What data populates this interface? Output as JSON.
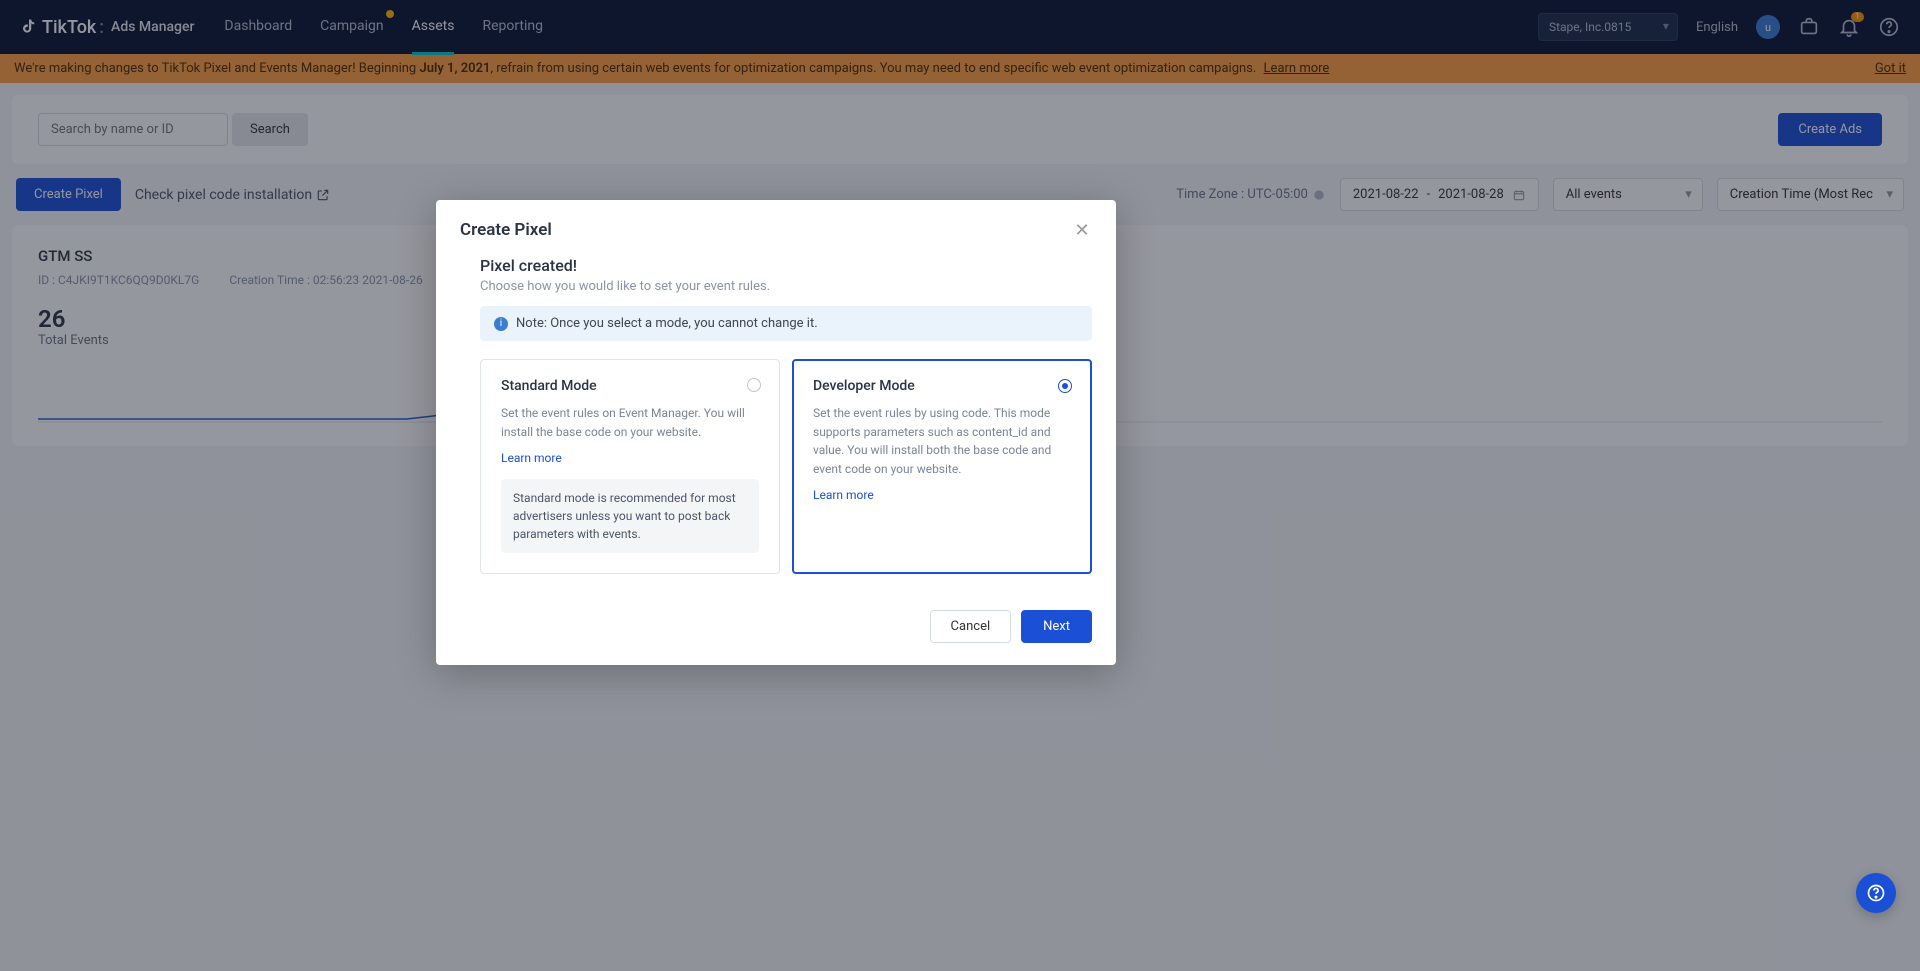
{
  "brand": {
    "name": "TikTok",
    "suffix": "Ads Manager"
  },
  "nav": {
    "items": [
      {
        "label": "Dashboard"
      },
      {
        "label": "Campaign",
        "badge": true
      },
      {
        "label": "Assets",
        "active": true
      },
      {
        "label": "Reporting"
      }
    ]
  },
  "topright": {
    "account": "Stape, Inc.0815",
    "language": "English",
    "avatar_initial": "u",
    "notif_count": "1"
  },
  "banner": {
    "prefix": "We're making changes to TikTok Pixel and Events Manager! Beginning ",
    "bold": "July 1, 2021",
    "suffix": ", refrain from using certain web events for optimization campaigns. You may need to end specific web event optimization campaigns. ",
    "learn_more": "Learn more",
    "got_it": "Got it"
  },
  "search": {
    "placeholder": "Search by name or ID",
    "button": "Search",
    "create_ads": "Create Ads"
  },
  "toolbar": {
    "create_pixel": "Create Pixel",
    "check_install": "Check pixel code installation",
    "timezone": "Time Zone : UTC-05:00",
    "date_from": "2021-08-22",
    "date_sep": "-",
    "date_to": "2021-08-28",
    "events_filter": "All events",
    "sort": "Creation Time (Most Rec"
  },
  "pixel": {
    "name": "GTM SS",
    "id_label": "ID : C4JKI9T1KC6QQ9D0KL7G",
    "creation_label": "Creation Time : 02:56:23 2021-08-26",
    "count": "26",
    "count_label": "Total Events"
  },
  "modal": {
    "title": "Create Pixel",
    "created_title": "Pixel created!",
    "created_sub": "Choose how you would like to set your event rules.",
    "note": "Note: Once you select a mode, you cannot change it.",
    "standard": {
      "title": "Standard Mode",
      "desc": "Set the event rules on Event Manager. You will install the base code on your website.",
      "learn": "Learn more",
      "reco": "Standard mode is recommended for most advertisers unless you want to post back parameters with events."
    },
    "developer": {
      "title": "Developer Mode",
      "desc": "Set the event rules by using code. This mode supports parameters such as content_id and value. You will install both the base code and event code on your website.",
      "learn": "Learn more"
    },
    "cancel": "Cancel",
    "next": "Next"
  }
}
